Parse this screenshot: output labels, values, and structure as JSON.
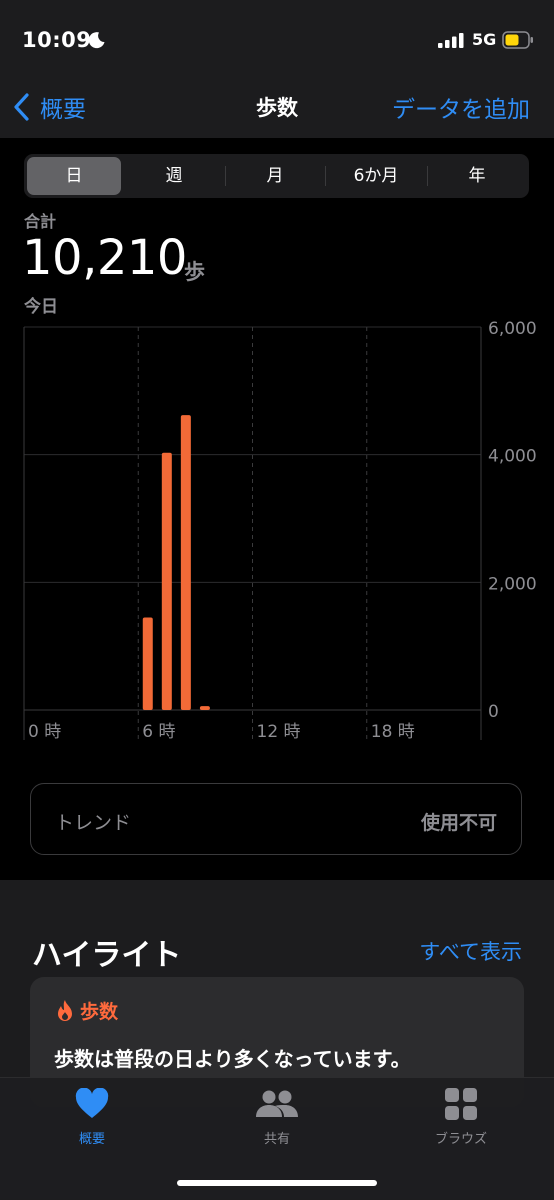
{
  "status_bar": {
    "time": "10:09",
    "network": "5G"
  },
  "nav": {
    "back_label": "概要",
    "title": "歩数",
    "add_data_label": "データを追加"
  },
  "segments": [
    {
      "label": "日",
      "active": true
    },
    {
      "label": "週",
      "active": false
    },
    {
      "label": "月",
      "active": false
    },
    {
      "label": "6か月",
      "active": false
    },
    {
      "label": "年",
      "active": false
    }
  ],
  "summary": {
    "total_label": "合計",
    "total_value": "10,210",
    "unit": "歩",
    "date_label": "今日"
  },
  "chart_data": {
    "type": "bar",
    "x": [
      6,
      7,
      8,
      9
    ],
    "values": [
      1450,
      4030,
      4620,
      60
    ],
    "x_ticks": [
      {
        "value": 0,
        "label": "0 時"
      },
      {
        "value": 6,
        "label": "6 時"
      },
      {
        "value": 12,
        "label": "12 時"
      },
      {
        "value": 18,
        "label": "18 時"
      }
    ],
    "y_ticks": [
      {
        "value": 0,
        "label": "0"
      },
      {
        "value": 2000,
        "label": "2,000"
      },
      {
        "value": 4000,
        "label": "4,000"
      },
      {
        "value": 6000,
        "label": "6,000"
      }
    ],
    "xlim": [
      0,
      24
    ],
    "ylim": [
      0,
      6000
    ],
    "bar_color": "#f26a37",
    "grid": true
  },
  "trend": {
    "label": "トレンド",
    "value": "使用不可"
  },
  "highlights": {
    "title": "ハイライト",
    "see_all": "すべて表示",
    "card": {
      "category": "歩数",
      "text": "歩数は普段の日より多くなっています。"
    }
  },
  "tab_bar": [
    {
      "label": "概要",
      "icon": "heart-icon",
      "active": true
    },
    {
      "label": "共有",
      "icon": "people-icon",
      "active": false
    },
    {
      "label": "ブラウズ",
      "icon": "grid-icon",
      "active": false
    }
  ],
  "colors": {
    "accent": "#2f8df5",
    "bar": "#f26a37",
    "highlight": "#ff6a3d"
  }
}
